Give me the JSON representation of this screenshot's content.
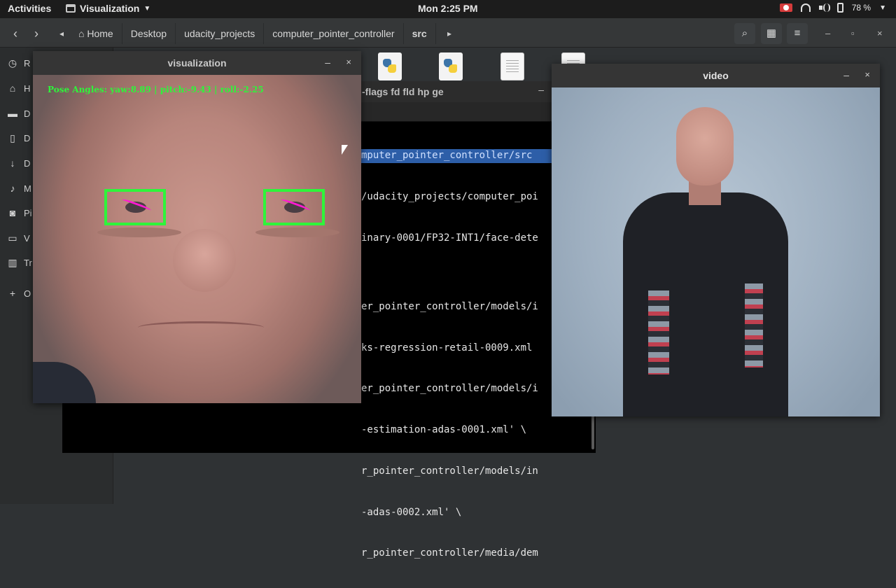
{
  "topbar": {
    "activities": "Activities",
    "app_menu": "Visualization",
    "clock": "Mon  2:25 PM",
    "battery": "78 %"
  },
  "files": {
    "breadcrumbs": [
      "Home",
      "Desktop",
      "udacity_projects",
      "computer_pointer_controller",
      "src"
    ]
  },
  "sidebar": {
    "items": [
      {
        "icon": "clock-icon",
        "glyph": "◷",
        "label": "R"
      },
      {
        "icon": "home-icon",
        "glyph": "⌂",
        "label": "H"
      },
      {
        "icon": "folder-icon",
        "glyph": "▬",
        "label": "D"
      },
      {
        "icon": "document-icon",
        "glyph": "▯",
        "label": "D"
      },
      {
        "icon": "download-icon",
        "glyph": "↓",
        "label": "D"
      },
      {
        "icon": "music-icon",
        "glyph": "♪",
        "label": "M"
      },
      {
        "icon": "camera-icon",
        "glyph": "◙",
        "label": "Pi"
      },
      {
        "icon": "video-icon",
        "glyph": "▭",
        "label": "V"
      },
      {
        "icon": "trash-icon",
        "glyph": "▥",
        "label": "Tr"
      },
      {
        "icon": "plus-icon",
        "glyph": "+",
        "label": "O"
      }
    ]
  },
  "terminal": {
    "title": "-flags fd fld hp ge",
    "lines": [
      "mputer_pointer_controller/src",
      "/udacity_projects/computer_poi",
      "inary-0001/FP32-INT1/face-dete",
      "",
      "er_pointer_controller/models/i",
      "ks-regression-retail-0009.xml ",
      "er_pointer_controller/models/i",
      "-estimation-adas-0001.xml' \\",
      "r_pointer_controller/models/in",
      "-adas-0002.xml' \\",
      "r_pointer_controller/media/dem"
    ]
  },
  "viz_window": {
    "title": "visualization",
    "pose_text": "Pose Angles: yaw:8.89 | pitch:-9.43 | roll:-2.25"
  },
  "video_window": {
    "title": "video"
  }
}
